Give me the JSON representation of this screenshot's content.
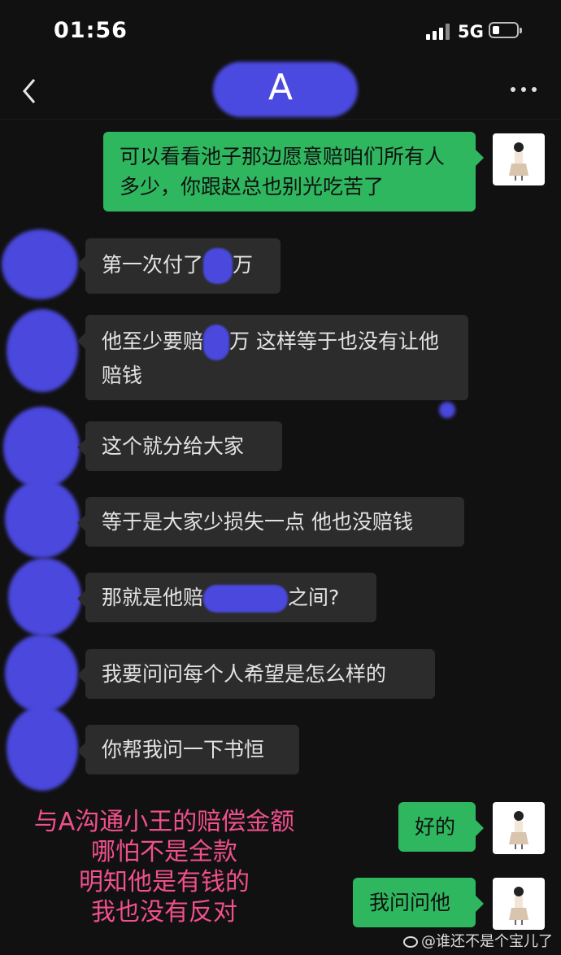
{
  "status_bar": {
    "time": "01:56",
    "network": "5G"
  },
  "nav": {
    "title": "A"
  },
  "messages": {
    "m1": "可以看看池子那边愿意赔咱们所有人多少，你跟赵总也别光吃苦了",
    "m2": {
      "before": "第一次付了",
      "after": "万"
    },
    "m3": {
      "before": "他至少要赔",
      "after": "万 这样等于也没有让他赔钱"
    },
    "m4": "这个就分给大家",
    "m5": "等于是大家少损失一点 他也没赔钱",
    "m6": {
      "before": "那就是他赔",
      "after": "之间?"
    },
    "m7": "我要问问每个人希望是怎么样的",
    "m8": "你帮我问一下书恒",
    "m9": "好的",
    "m10": "我问问他"
  },
  "annotation": {
    "line1": "与A沟通小王的赔偿金额",
    "line2": "哪怕不是全款",
    "line3": "明知他是有钱的",
    "line4": "我也没有反对"
  },
  "watermark": "@谁还不是个宝儿了",
  "colors": {
    "accent_outgoing": "#2fb75f",
    "incoming_bubble": "#2c2c2c",
    "redaction": "#4a48dd",
    "annotation": "#f0508c"
  },
  "icons": [
    "back-icon",
    "more-icon",
    "signal-icon",
    "battery-icon",
    "weibo-icon"
  ]
}
